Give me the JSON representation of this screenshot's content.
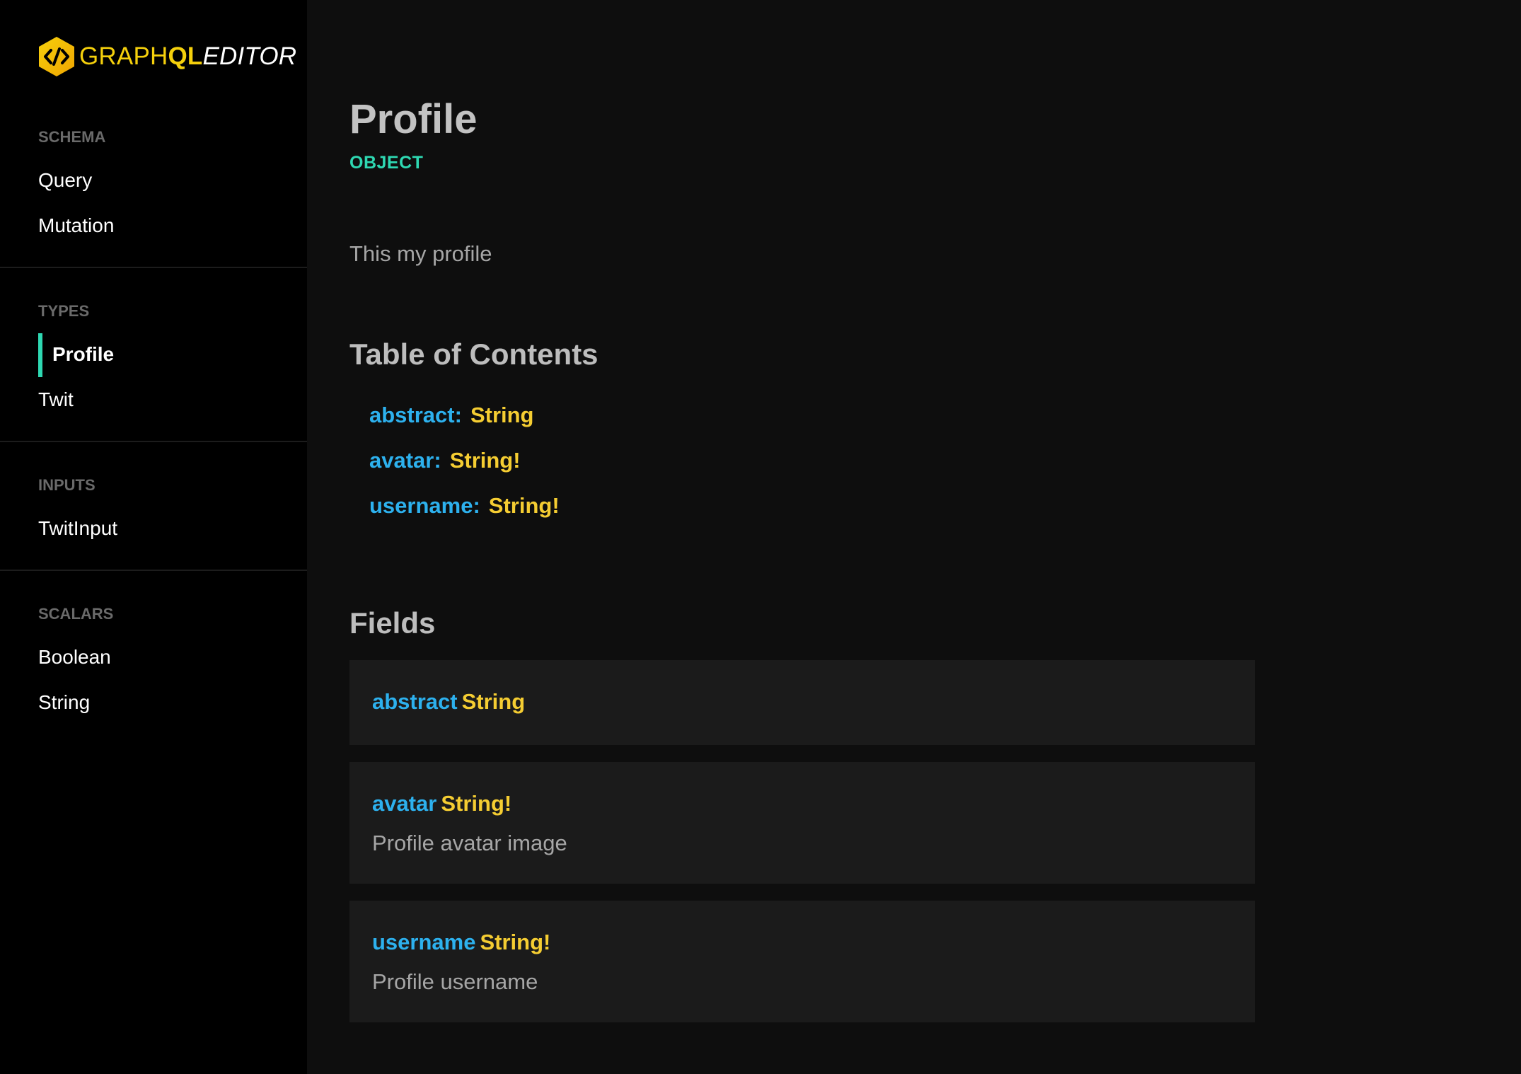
{
  "brand": {
    "part1": "GRAPH",
    "part2": "QL",
    "part3": "EDITOR"
  },
  "sidebar": {
    "sections": [
      {
        "heading": "SCHEMA",
        "items": [
          "Query",
          "Mutation"
        ]
      },
      {
        "heading": "TYPES",
        "items": [
          "Profile",
          "Twit"
        ]
      },
      {
        "heading": "INPUTS",
        "items": [
          "TwitInput"
        ]
      },
      {
        "heading": "SCALARS",
        "items": [
          "Boolean",
          "String"
        ]
      }
    ],
    "active_item": "Profile"
  },
  "main": {
    "title": "Profile",
    "kind": "OBJECT",
    "description": "This my profile",
    "toc_heading": "Table of Contents",
    "toc": [
      {
        "name": "abstract:",
        "type": "String"
      },
      {
        "name": "avatar:",
        "type": "String!"
      },
      {
        "name": "username:",
        "type": "String!"
      }
    ],
    "fields_heading": "Fields",
    "fields": [
      {
        "name": "abstract",
        "type": "String",
        "description": ""
      },
      {
        "name": "avatar",
        "type": "String!",
        "description": "Profile avatar image"
      },
      {
        "name": "username",
        "type": "String!",
        "description": "Profile username"
      }
    ]
  },
  "colors": {
    "accent_teal": "#2ed8b2",
    "field_blue": "#2db1ee",
    "type_yellow": "#f5cd32",
    "brand_yellow": "#f5d00c"
  }
}
